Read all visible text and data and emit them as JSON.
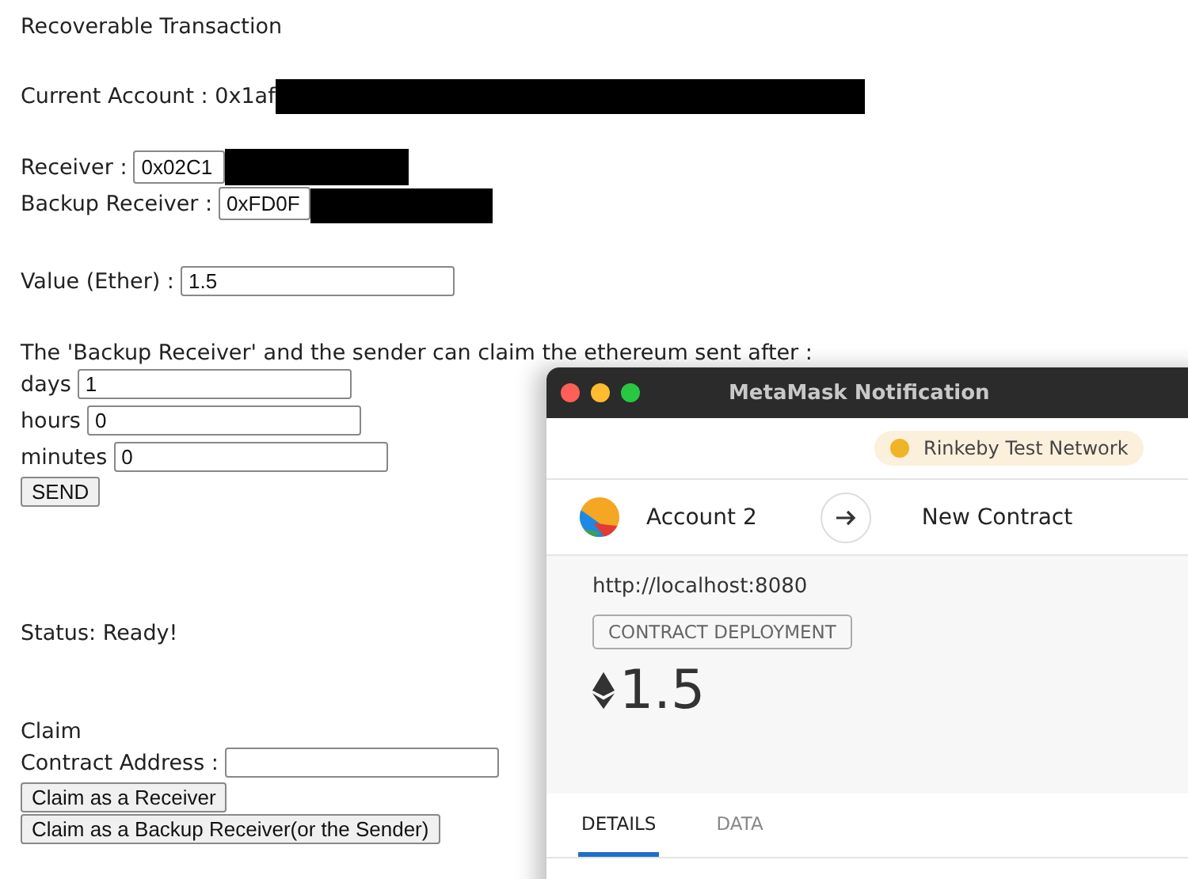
{
  "page": {
    "title": "Recoverable Transaction",
    "current_account": {
      "label": "Current Account :",
      "value": "0x1af",
      "redacted": true
    },
    "receiver": {
      "label": "Receiver :",
      "value": "0x02C1",
      "redacted": true
    },
    "backup_receiver": {
      "label": "Backup Receiver :",
      "value": "0xFD0F",
      "redacted": true
    },
    "value": {
      "label": "Value (Ether) :",
      "value": "1.5"
    },
    "claim_note": "The 'Backup Receiver' and the sender can claim the ethereum sent after :",
    "durations": [
      {
        "label": "days",
        "value": "1"
      },
      {
        "label": "hours",
        "value": "0"
      },
      {
        "label": "minutes",
        "value": "0"
      }
    ],
    "send_button": "SEND",
    "status": "Status: Ready!",
    "claim": {
      "title": "Claim",
      "address_label": "Contract Address :",
      "buttons": [
        "Claim as a Receiver",
        "Claim as a Backup Receiver(or the Sender)"
      ]
    }
  },
  "popup": {
    "title": "MetaMask Notification",
    "network": {
      "name": "Rinkeby Test Network",
      "color": "#f0b429"
    },
    "from": "Account 2",
    "to": "New Contract",
    "origin": "http://localhost:8080",
    "tag": "CONTRACT DEPLOYMENT",
    "amount": "1.5",
    "tabs": [
      {
        "label": "DETAILS",
        "selected": true
      },
      {
        "label": "DATA",
        "selected": false
      }
    ]
  }
}
